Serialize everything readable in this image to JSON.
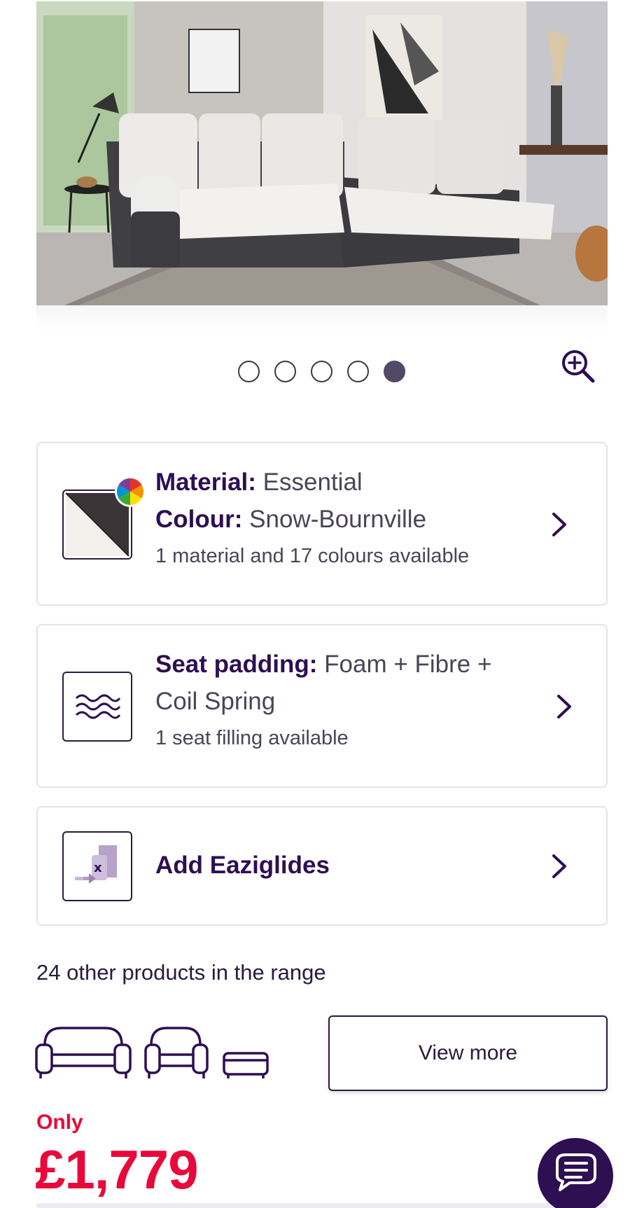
{
  "hero": {
    "alt": "Corner sofa in Snow-Bournville leather"
  },
  "carousel": {
    "dot_count": 5,
    "active_index": 4
  },
  "icons": {
    "zoom": "zoom-in-icon",
    "colour_wheel": "colour-wheel-icon",
    "padding": "waves-icon",
    "eazi": "eaziglides-icon",
    "chevron": "chevron-right-icon",
    "chat": "chat-icon"
  },
  "material_card": {
    "material_label": "Material:",
    "material_value": "Essential",
    "colour_label": "Colour:",
    "colour_value": "Snow-Bournville",
    "availability": "1 material and 17 colours available"
  },
  "padding_card": {
    "label": "Seat padding:",
    "value": "Foam + Fibre +",
    "value_line2": "Coil Spring",
    "availability": "1 seat filling available"
  },
  "eazi_card": {
    "label": "Add Eaziglides"
  },
  "range": {
    "text": "24 other products in the range",
    "view_more": "View more"
  },
  "price": {
    "prefix": "Only",
    "amount": "£1,779"
  },
  "colors": {
    "brand_purple": "#2e0f52",
    "price_red": "#e8093a",
    "border": "#e3e3e8"
  }
}
